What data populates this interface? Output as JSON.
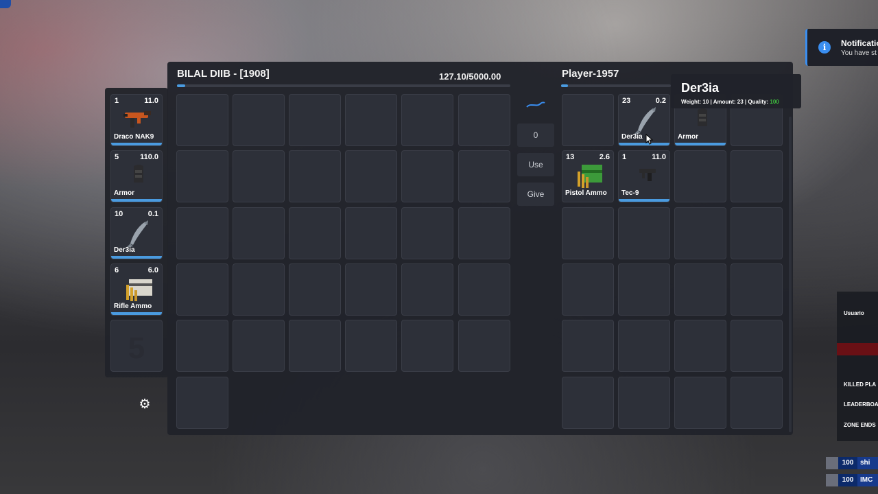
{
  "player_inventory": {
    "title": "BILAL DIIB - [1908]",
    "weight_text": "127.10/5000.00",
    "weight_fraction": 0.025
  },
  "other_inventory": {
    "title": "Player-1957",
    "weight_fraction": 0.06
  },
  "hotbar": [
    {
      "qty": "1",
      "weight": "11.0",
      "name": "Draco NAK9",
      "icon": "rifle-icon"
    },
    {
      "qty": "5",
      "weight": "110.0",
      "name": "Armor",
      "icon": "armor-vest-icon"
    },
    {
      "qty": "10",
      "weight": "0.1",
      "name": "Der3ia",
      "icon": "fish-icon"
    },
    {
      "qty": "6",
      "weight": "6.0",
      "name": "Rifle Ammo",
      "icon": "ammo-box-icon"
    },
    {
      "ghost": "5"
    }
  ],
  "middle_controls": {
    "amount_value": "0",
    "use_label": "Use",
    "give_label": "Give"
  },
  "other_items": [
    {
      "qty": "23",
      "weight": "0.2",
      "name": "Der3ia",
      "icon": "fish-icon"
    },
    {
      "name": "Armor",
      "icon": "armor-vest-icon"
    },
    {
      "qty": "13",
      "weight": "2.6",
      "name": "Pistol Ammo",
      "icon": "ammo-box-icon"
    },
    {
      "qty": "1",
      "weight": "11.0",
      "name": "Tec-9",
      "icon": "pistol-icon"
    }
  ],
  "tooltip": {
    "title": "Der3ia",
    "info": "Weight: 10 | Amount: 23 | Quality: 100"
  },
  "notification": {
    "title": "Notificatio",
    "body": "You have st"
  },
  "scoreboard": {
    "header": "Usuario",
    "killed": "KILLED PLA",
    "leaderboard": "LEADERBOA",
    "zone": "ZONE ENDS"
  },
  "scores": [
    {
      "score": "100",
      "name": "shi"
    },
    {
      "score": "100",
      "name": "IMC"
    }
  ],
  "colors": {
    "accent": "#4a9be0",
    "panel": "#21232a",
    "slot": "#2d3039",
    "quality_green": "#3fbf3f"
  }
}
